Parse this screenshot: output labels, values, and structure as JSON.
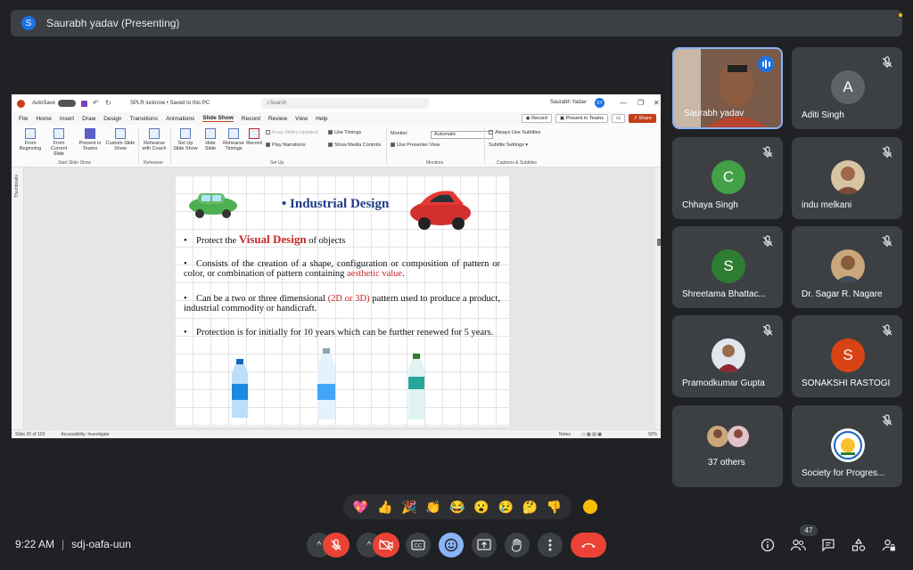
{
  "presenter": {
    "initial": "S",
    "label": "Saurabh yadav (Presenting)"
  },
  "ppt": {
    "autosave": "AutoSave",
    "toggle_state": "Off",
    "doc_title": "SPLR lucknow • Saved to this PC",
    "search_placeholder": "Search",
    "user": "Saurabh Yadav",
    "user_initial": "SY",
    "menu": [
      "File",
      "Home",
      "Insert",
      "Draw",
      "Design",
      "Transitions",
      "Animations",
      "Slide Show",
      "Record",
      "Review",
      "View",
      "Help"
    ],
    "active_menu": "Slide Show",
    "record_label": "Record",
    "present_teams_label": "Present in Teams",
    "share_label": "Share",
    "ribbon": {
      "from_beginning": "From Beginning",
      "from_current": "From Current Slide",
      "present_teams": "Present in Teams",
      "custom_show": "Custom Slide Show",
      "rehearse_coach": "Rehearse with Coach",
      "setup_show": "Set Up Slide Show",
      "hide_slide": "Hide Slide",
      "rehearse_timings": "Rehearse Timings",
      "record": "Record",
      "keep_updated": "Keep Slides Updated",
      "play_narrations": "Play Narrations",
      "use_timings": "Use Timings",
      "show_media": "Show Media Controls",
      "monitor_label": "Monitor:",
      "monitor_value": "Automatic",
      "presenter_view": "Use Presenter View",
      "always_subtitles": "Always Use Subtitles",
      "subtitle_settings": "Subtitle Settings",
      "group_start": "Start Slide Show",
      "group_rehearse": "Rehearse",
      "group_setup": "Set Up",
      "group_monitors": "Monitors",
      "group_captions": "Captions & Subtitles"
    },
    "thumbnails": "Thumbnails",
    "status": {
      "slide": "Slide 20 of 103",
      "accessibility": "Accessibility: Investigate",
      "notes": "Notes",
      "zoom": "92%"
    }
  },
  "slide": {
    "title": "Industrial Design",
    "b1_pre": "Protect the ",
    "b1_em": "Visual Design",
    "b1_post": " of objects",
    "b2_pre": "Consists of the creation of a shape, configuration or composition of pattern or color, or combination of pattern containing ",
    "b2_em": "aesthetic value",
    "b2_post": ".",
    "b3_pre": "Can be a two or three dimensional ",
    "b3_em": "(2D or 3D)",
    "b3_post": " pattern used to produce a product, industrial commodity or handicraft.",
    "b4": "Protection is for initially for 10 years which can be further renewed for 5 years."
  },
  "participants": [
    {
      "name": "Saurabh yadav",
      "type": "video"
    },
    {
      "name": "Aditi Singh",
      "initial": "A",
      "color": "#5f6368"
    },
    {
      "name": "Chhaya Singh",
      "initial": "C",
      "color": "#43a047"
    },
    {
      "name": "indu melkani",
      "type": "photo"
    },
    {
      "name": "Shreetama Bhattac...",
      "initial": "S",
      "color": "#2e7d32"
    },
    {
      "name": "Dr. Sagar R. Nagare",
      "type": "photo"
    },
    {
      "name": "Pramodkumar Gupta",
      "type": "photo"
    },
    {
      "name": "SONAKSHI RASTOGI",
      "initial": "S",
      "color": "#d84315"
    },
    {
      "name": "37 others",
      "type": "group"
    },
    {
      "name": "Society for Progres...",
      "type": "logo"
    }
  ],
  "reactions": [
    "💖",
    "👍",
    "🎉",
    "👏",
    "😂",
    "😮",
    "😢",
    "🤔",
    "👎"
  ],
  "meeting": {
    "time": "9:22 AM",
    "code": "sdj-oafa-uun"
  },
  "participant_count": "47",
  "colors": {
    "end_call": "#ea4335",
    "accent": "#8ab4f8",
    "tile_bg": "#3c4043"
  }
}
